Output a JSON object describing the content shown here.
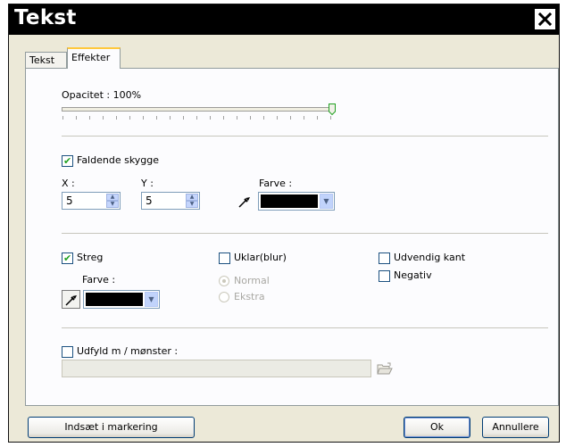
{
  "window": {
    "title": "Tekst"
  },
  "tabs": [
    {
      "label": "Tekst",
      "active": false
    },
    {
      "label": "Effekter",
      "active": true
    }
  ],
  "opacity": {
    "label": "Opacitet : 100%",
    "value_percent": 100
  },
  "drop_shadow": {
    "label": "Faldende skygge",
    "checked": true,
    "x_label": "X :",
    "x_value": "5",
    "y_label": "Y :",
    "y_value": "5",
    "color_label": "Farve :",
    "color": "#000000"
  },
  "stroke": {
    "label": "Streg",
    "checked": true,
    "color_label": "Farve :",
    "color": "#000000"
  },
  "blur": {
    "label": "Uklar(blur)",
    "checked": false,
    "options": [
      {
        "label": "Normal",
        "selected": true
      },
      {
        "label": "Ekstra",
        "selected": false
      }
    ]
  },
  "outer_edge": {
    "label": "Udvendig kant",
    "checked": false
  },
  "negative": {
    "label": "Negativ",
    "checked": false
  },
  "fill_pattern": {
    "label": "Udfyld m / mønster :",
    "checked": false,
    "path": ""
  },
  "buttons": {
    "insert": "Indsæt i markering",
    "ok": "Ok",
    "cancel": "Annullere"
  },
  "icons": {
    "close": "close-icon",
    "eyedropper": "eyedropper-icon",
    "folder": "open-folder-icon",
    "spin": "spin-arrows-icon",
    "dropdown": "chevron-down-icon"
  }
}
